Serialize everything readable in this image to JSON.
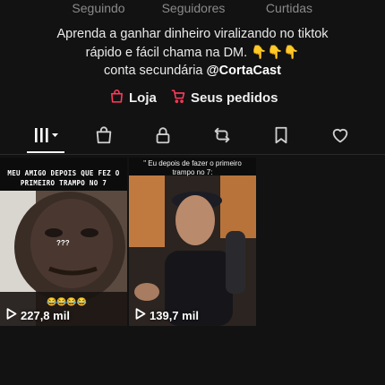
{
  "stats": {
    "following_label": "Seguindo",
    "followers_label": "Seguidores",
    "likes_label": "Curtidas"
  },
  "bio": {
    "line1": "Aprenda a ganhar dinheiro viralizando no tiktok",
    "line2_text": "rápido e fácil chama na DM.",
    "line2_emoji": "👇👇👇",
    "line3_text": "conta secundária",
    "line3_handle": "@CortaCast"
  },
  "shop": {
    "store_label": "Loja",
    "orders_label": "Seus pedidos",
    "accent": "#ff3b5c"
  },
  "tabs": [
    {
      "icon": "grid-icon",
      "active": true
    },
    {
      "icon": "shopping-bag-icon",
      "active": false
    },
    {
      "icon": "lock-icon",
      "active": false
    },
    {
      "icon": "repost-icon",
      "active": false
    },
    {
      "icon": "bookmark-icon",
      "active": false
    },
    {
      "icon": "heart-icon",
      "active": false
    }
  ],
  "videos": [
    {
      "caption": "MEU AMIGO DEPOIS QUE FEZ O PRIMEIRO TRAMPO NO 7",
      "overlay_text": "???",
      "emoji": "😂😂😂😂",
      "views": "227,8 mil"
    },
    {
      "caption": "\" Eu depois de fazer o primeiro trampo no 7:",
      "views": "139,7 mil"
    }
  ]
}
